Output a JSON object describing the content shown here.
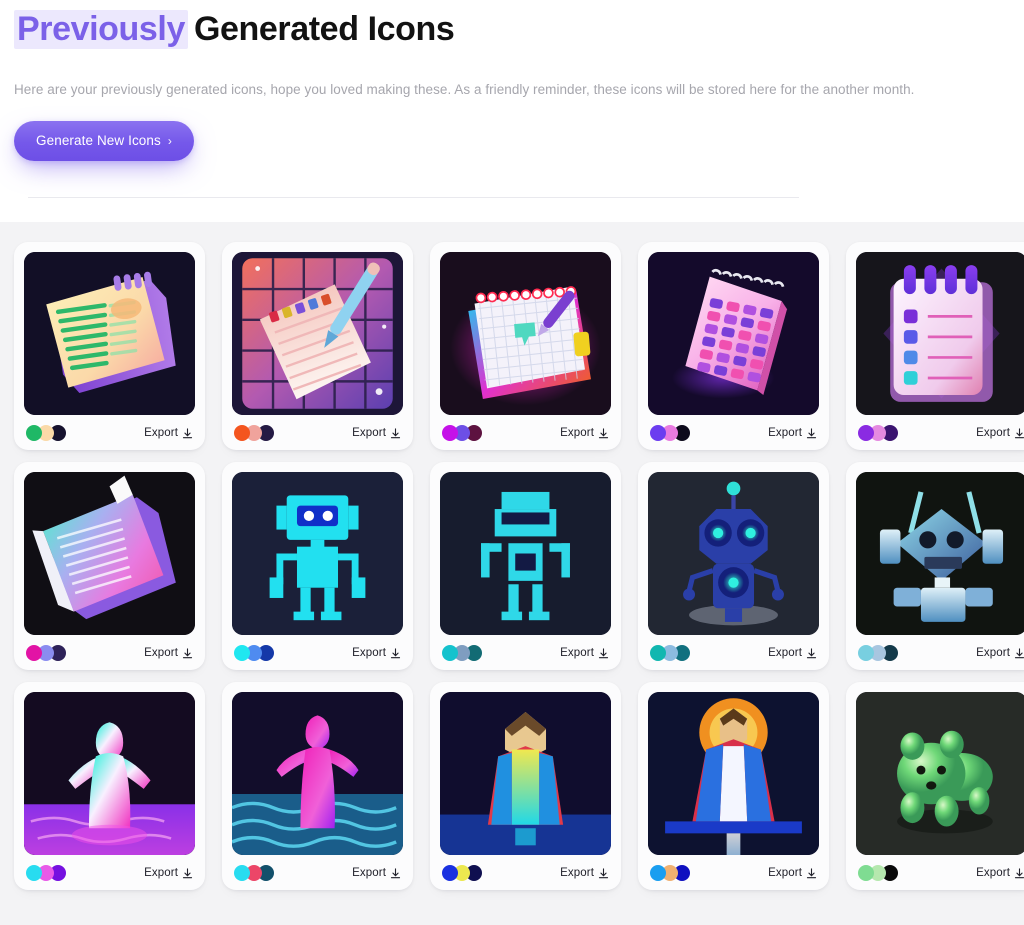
{
  "header": {
    "title_highlight": "Previously",
    "title_rest": "Generated Icons",
    "subtitle": "Here are your previously generated icons, hope you loved making these. As a friendly reminder, these icons will be stored here for the another month.",
    "cta_label": "Generate New Icons",
    "cta_chevron": "›",
    "highlight_color": "#7b61e8",
    "highlight_bg": "#ece8fd",
    "accent_color": "#7558ea"
  },
  "gallery": {
    "export_label": "Export",
    "export_icon": "download-icon",
    "background": "#f3f3f5",
    "columns": 5,
    "cards": [
      {
        "name": "notepad-green-lines",
        "art": "notebook-lined",
        "bg": "#120f26",
        "swatches": [
          "#1fb866",
          "#fad9a8",
          "#16122e"
        ]
      },
      {
        "name": "notepad-pen-grid",
        "art": "notepad-pen-grid",
        "bg": "#231a3d",
        "swatches": [
          "#f4551f",
          "#f0a39c",
          "#241a44"
        ]
      },
      {
        "name": "neon-spiral-notepad",
        "art": "neon-notepad",
        "bg": "#190d1d",
        "swatches": [
          "#c511e8",
          "#6d4fe6",
          "#5d1240"
        ]
      },
      {
        "name": "pink-calendar-pad",
        "art": "pink-calendar",
        "bg": "#140a2b",
        "swatches": [
          "#6c3df0",
          "#e87ae0",
          "#0d0a1c"
        ]
      },
      {
        "name": "checklist-notepad",
        "art": "checklist-pad",
        "bg": "#16151b",
        "swatches": [
          "#8a2be2",
          "#e58ae0",
          "#3b1470"
        ]
      },
      {
        "name": "rainbow-book",
        "art": "rainbow-book",
        "bg": "#100e14",
        "swatches": [
          "#e213a5",
          "#8a8cf0",
          "#2e2259"
        ]
      },
      {
        "name": "pixel-robot-cyan",
        "art": "pixel-robot",
        "bg": "#1b2039",
        "swatches": [
          "#20e7f0",
          "#4f8bf0",
          "#1438a8"
        ]
      },
      {
        "name": "pixel-robot-blue",
        "art": "pixel-robot-2",
        "bg": "#171c2e",
        "swatches": [
          "#15c2cd",
          "#7f9dc0",
          "#126b74"
        ]
      },
      {
        "name": "glowing-robot",
        "art": "glow-robot",
        "bg": "#222733",
        "swatches": [
          "#12b7b0",
          "#8cbbe0",
          "#11707f"
        ]
      },
      {
        "name": "metal-robot-head",
        "art": "metal-robot",
        "bg": "#101410",
        "swatches": [
          "#78cfe0",
          "#a8c6e0",
          "#143a4a"
        ]
      },
      {
        "name": "neon-figure-water-purple",
        "art": "neon-figure-1",
        "bg": "#140b21",
        "swatches": [
          "#28dcf0",
          "#e85ae8",
          "#7510e0"
        ]
      },
      {
        "name": "neon-figure-water-pink",
        "art": "neon-figure-2",
        "bg": "#120d2b",
        "swatches": [
          "#28dcf0",
          "#ec4668",
          "#12506b"
        ]
      },
      {
        "name": "lowpoly-figure-robe",
        "art": "lowpoly-figure",
        "bg": "#100d2e",
        "swatches": [
          "#1a31e0",
          "#ece84f",
          "#0f0f50"
        ]
      },
      {
        "name": "haloed-figure-rocket",
        "art": "halo-figure",
        "bg": "#0d1230",
        "swatches": [
          "#1a9ef0",
          "#f0b070",
          "#0f10c0"
        ]
      },
      {
        "name": "green-toy-bear",
        "art": "green-bear",
        "bg": "#272b27",
        "swatches": [
          "#7fdc92",
          "#b5e8ae",
          "#0a0a0a"
        ]
      }
    ]
  }
}
